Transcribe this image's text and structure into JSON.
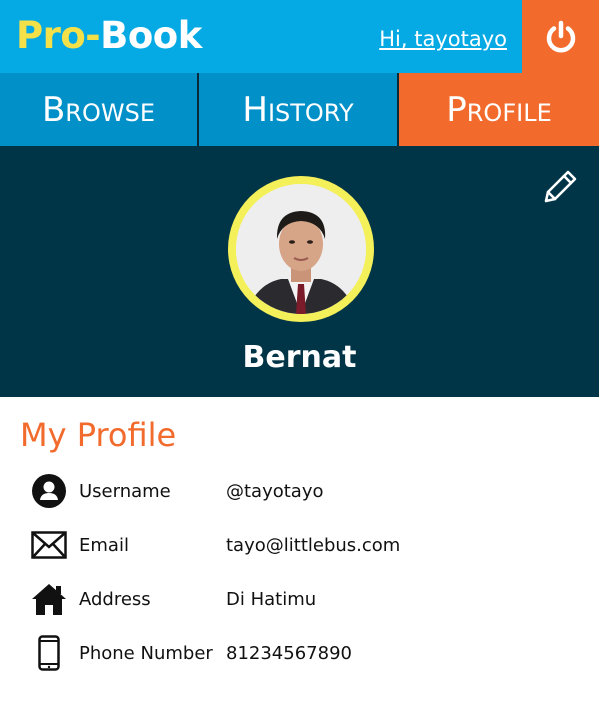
{
  "header": {
    "logo_pro": "Pro",
    "logo_dash": "-",
    "logo_book": "Book",
    "greeting": "Hi, tayotayo",
    "logout_icon": "power-icon"
  },
  "nav": {
    "tabs": [
      {
        "label": "Browse",
        "active": false
      },
      {
        "label": "History",
        "active": false
      },
      {
        "label": "Profile",
        "active": true
      }
    ]
  },
  "banner": {
    "edit_icon": "pencil-icon",
    "name": "Bernat"
  },
  "profile": {
    "title": "My Profile",
    "fields": [
      {
        "icon": "user-icon",
        "label": "Username",
        "value": "@tayotayo"
      },
      {
        "icon": "envelope-icon",
        "label": "Email",
        "value": "tayo@littlebus.com"
      },
      {
        "icon": "home-icon",
        "label": "Address",
        "value": "Di Hatimu"
      },
      {
        "icon": "phone-icon",
        "label": "Phone Number",
        "value": "81234567890"
      }
    ]
  },
  "colors": {
    "header_blue": "#05a9e4",
    "nav_blue": "#0190c8",
    "accent_orange": "#f26a2c",
    "logo_yellow": "#f4e14a",
    "banner_navy": "#003547",
    "avatar_ring": "#f4f05a"
  }
}
